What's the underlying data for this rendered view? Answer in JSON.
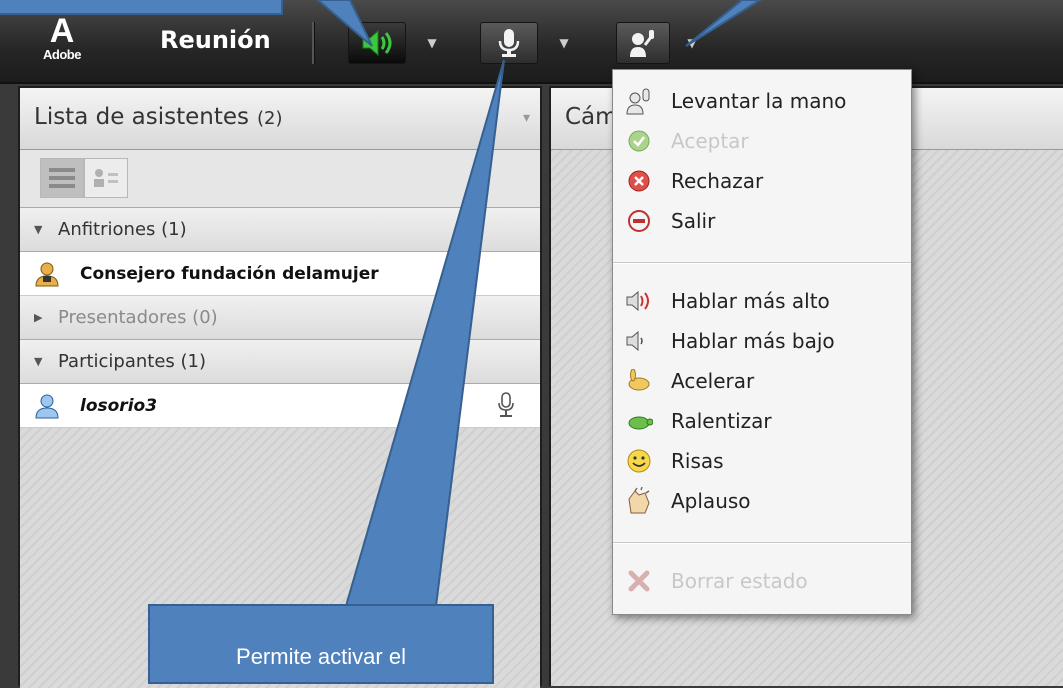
{
  "toolbar": {
    "logo_text": "Adobe",
    "title": "Reunión",
    "speaker_button": "speaker-icon",
    "mic_button": "microphone-icon",
    "status_button": "raise-hand-icon"
  },
  "attendees_panel": {
    "title": "Lista de asistentes",
    "count": "(2)",
    "groups": [
      {
        "label": "Anfitriones (1)"
      },
      {
        "label": "Presentadores (0)"
      },
      {
        "label": "Participantes (1)"
      }
    ],
    "hosts": [
      {
        "name": "Consejero fundación delamujer"
      }
    ],
    "participants": [
      {
        "name": "losorio3"
      }
    ]
  },
  "camera_panel": {
    "title": "Cám"
  },
  "status_menu": {
    "items": [
      {
        "label": "Levantar la mano",
        "icon": "raise-hand-icon",
        "enabled": true
      },
      {
        "label": "Aceptar",
        "icon": "check-icon",
        "enabled": false
      },
      {
        "label": "Rechazar",
        "icon": "reject-icon",
        "enabled": true
      },
      {
        "label": "Salir",
        "icon": "exit-icon",
        "enabled": true
      },
      {
        "label": "Hablar más alto",
        "icon": "louder-icon",
        "enabled": true
      },
      {
        "label": "Hablar más bajo",
        "icon": "softer-icon",
        "enabled": true
      },
      {
        "label": "Acelerar",
        "icon": "rabbit-icon",
        "enabled": true
      },
      {
        "label": "Ralentizar",
        "icon": "turtle-icon",
        "enabled": true
      },
      {
        "label": "Risas",
        "icon": "smiley-icon",
        "enabled": true
      },
      {
        "label": "Aplauso",
        "icon": "applause-icon",
        "enabled": true
      },
      {
        "label": "Borrar estado",
        "icon": "clear-status-icon",
        "enabled": false
      }
    ]
  },
  "callout": {
    "text": "Permite activar el"
  },
  "colors": {
    "callout_blue": "#4f81bd",
    "speaker_green": "#3cc83c",
    "toolbar_dark": "#262626"
  }
}
